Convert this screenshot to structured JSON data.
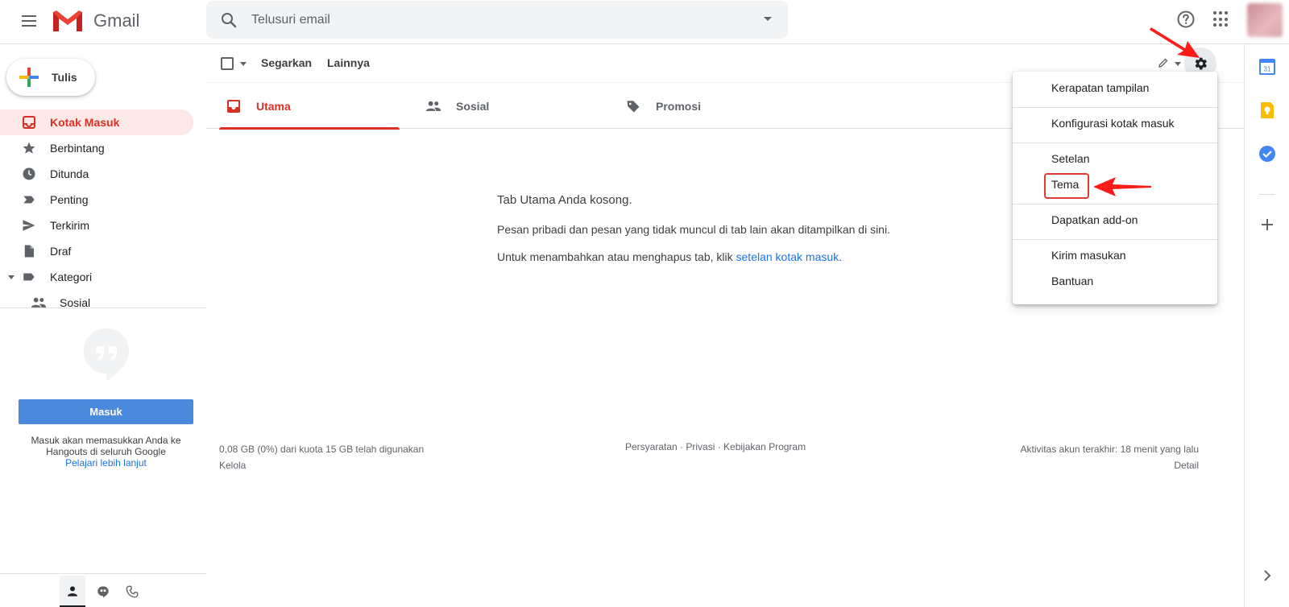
{
  "header": {
    "app_name": "Gmail",
    "search_placeholder": "Telusuri email"
  },
  "sidebar": {
    "compose_label": "Tulis",
    "items": [
      {
        "label": "Kotak Masuk",
        "icon": "inbox-icon",
        "active": true
      },
      {
        "label": "Berbintang",
        "icon": "star-icon"
      },
      {
        "label": "Ditunda",
        "icon": "clock-icon"
      },
      {
        "label": "Penting",
        "icon": "label-important-icon"
      },
      {
        "label": "Terkirim",
        "icon": "send-icon"
      },
      {
        "label": "Draf",
        "icon": "draft-icon"
      },
      {
        "label": "Kategori",
        "icon": "label-icon"
      },
      {
        "label": "Sosial",
        "icon": "people-icon"
      }
    ],
    "hangouts": {
      "signin_label": "Masuk",
      "description": "Masuk akan memasukkan Anda ke Hangouts di seluruh Google",
      "learn_more": "Pelajari lebih lanjut"
    }
  },
  "toolbar": {
    "refresh_label": "Segarkan",
    "more_label": "Lainnya"
  },
  "tabs": [
    {
      "label": "Utama",
      "icon": "inbox-icon",
      "active": true
    },
    {
      "label": "Sosial",
      "icon": "people-icon"
    },
    {
      "label": "Promosi",
      "icon": "tag-icon"
    }
  ],
  "empty_state": {
    "title": "Tab Utama Anda kosong.",
    "line1": "Pesan pribadi dan pesan yang tidak muncul di tab lain akan ditampilkan di sini.",
    "line2_prefix": "Untuk menambahkan atau menghapus tab, klik ",
    "line2_link": "setelan kotak masuk",
    "line2_suffix": "."
  },
  "footer": {
    "storage": "0,08 GB (0%) dari kuota 15 GB telah digunakan",
    "manage": "Kelola",
    "links": "Persyaratan · Privasi · Kebijakan Program",
    "activity": "Aktivitas akun terakhir: 18 menit yang lalu",
    "details": "Detail"
  },
  "settings_menu": {
    "items": [
      "Kerapatan tampilan",
      "Konfigurasi kotak masuk",
      "Setelan",
      "Tema",
      "Dapatkan add-on",
      "Kirim masukan",
      "Bantuan"
    ]
  },
  "side_panel": {
    "calendar_day": "31"
  },
  "colors": {
    "accent_red": "#d93025",
    "active_bg": "#fce8e6",
    "link_blue": "#1a73e8",
    "annotation_red": "#e53935",
    "signin_blue": "#4a89dc"
  }
}
